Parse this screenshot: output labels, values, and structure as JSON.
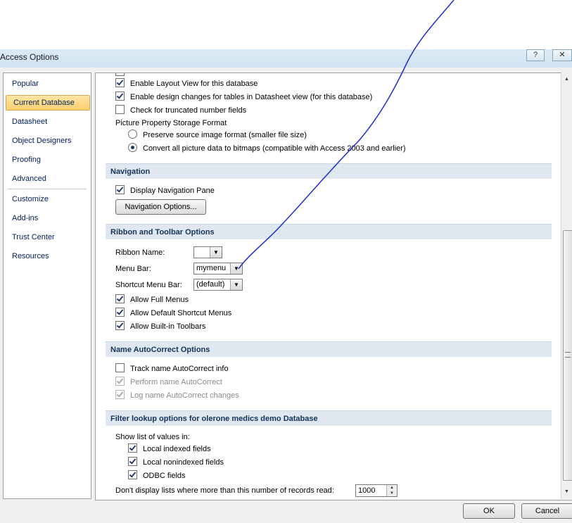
{
  "window": {
    "title": "Access Options",
    "help_label": "?",
    "close_label": "✕"
  },
  "sidebar": {
    "items": [
      {
        "label": "Popular"
      },
      {
        "label": "Current Database"
      },
      {
        "label": "Datasheet"
      },
      {
        "label": "Object Designers"
      },
      {
        "label": "Proofing"
      },
      {
        "label": "Advanced"
      },
      {
        "label": "Customize"
      },
      {
        "label": "Add-ins"
      },
      {
        "label": "Trust Center"
      },
      {
        "label": "Resources"
      }
    ],
    "selected": "Current Database"
  },
  "application_options": {
    "layout_view": "Enable Layout View for this database",
    "design_changes": "Enable design changes for tables in Datasheet view (for this database)",
    "truncated_fields": "Check for truncated number fields",
    "picture_format_label": "Picture Property Storage Format",
    "preserve_format": "Preserve source image format (smaller file size)",
    "convert_bitmaps": "Convert all picture data to bitmaps (compatible with Access 2003 and earlier)",
    "selected_format": "convert_bitmaps"
  },
  "navigation": {
    "header": "Navigation",
    "display_pane": "Display Navigation Pane",
    "options_button": "Navigation Options..."
  },
  "ribbon": {
    "header": "Ribbon and Toolbar Options",
    "ribbon_name_label": "Ribbon Name:",
    "ribbon_name_value": "",
    "menu_bar_label": "Menu Bar:",
    "menu_bar_value": "mymenu",
    "shortcut_menu_label": "Shortcut Menu Bar:",
    "shortcut_menu_value": "(default)",
    "full_menus": "Allow Full Menus",
    "default_shortcut": "Allow Default Shortcut Menus",
    "builtin_toolbars": "Allow Built-in Toolbars"
  },
  "autocorrect": {
    "header": "Name AutoCorrect Options",
    "track": "Track name AutoCorrect info",
    "perform": "Perform name AutoCorrect",
    "log": "Log name AutoCorrect changes"
  },
  "filter": {
    "header": "Filter lookup options for olerone medics demo Database",
    "show_list_label": "Show list of values in:",
    "local_indexed": "Local indexed fields",
    "local_nonindexed": "Local nonindexed fields",
    "odbc": "ODBC fields",
    "records_label": "Don't display lists where more than this number of records read:",
    "records_value": "1000"
  },
  "footer": {
    "ok": "OK",
    "cancel": "Cancel"
  }
}
